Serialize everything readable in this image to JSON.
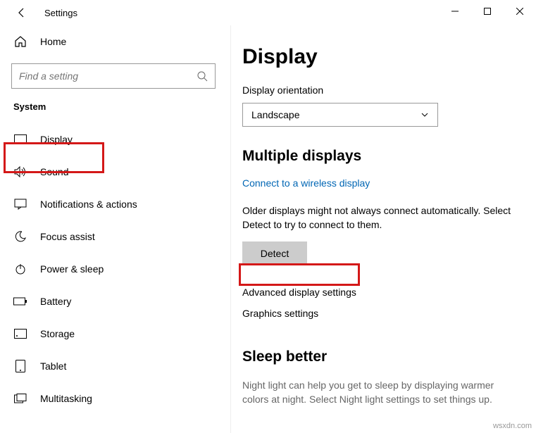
{
  "window": {
    "title": "Settings"
  },
  "sidebar": {
    "home": "Home",
    "search_placeholder": "Find a setting",
    "category": "System",
    "items": [
      {
        "label": "Display"
      },
      {
        "label": "Sound"
      },
      {
        "label": "Notifications & actions"
      },
      {
        "label": "Focus assist"
      },
      {
        "label": "Power & sleep"
      },
      {
        "label": "Battery"
      },
      {
        "label": "Storage"
      },
      {
        "label": "Tablet"
      },
      {
        "label": "Multitasking"
      }
    ]
  },
  "content": {
    "page_title": "Display",
    "orientation_label": "Display orientation",
    "orientation_value": "Landscape",
    "multi_h": "Multiple displays",
    "wireless_link": "Connect to a wireless display",
    "older_text": "Older displays might not always connect automatically. Select Detect to try to connect to them.",
    "detect_btn": "Detect",
    "adv_link": "Advanced display settings",
    "gfx_link": "Graphics settings",
    "sleep_h": "Sleep better",
    "sleep_desc": "Night light can help you get to sleep by displaying warmer colors at night. Select Night light settings to set things up."
  },
  "watermark": "wsxdn.com"
}
